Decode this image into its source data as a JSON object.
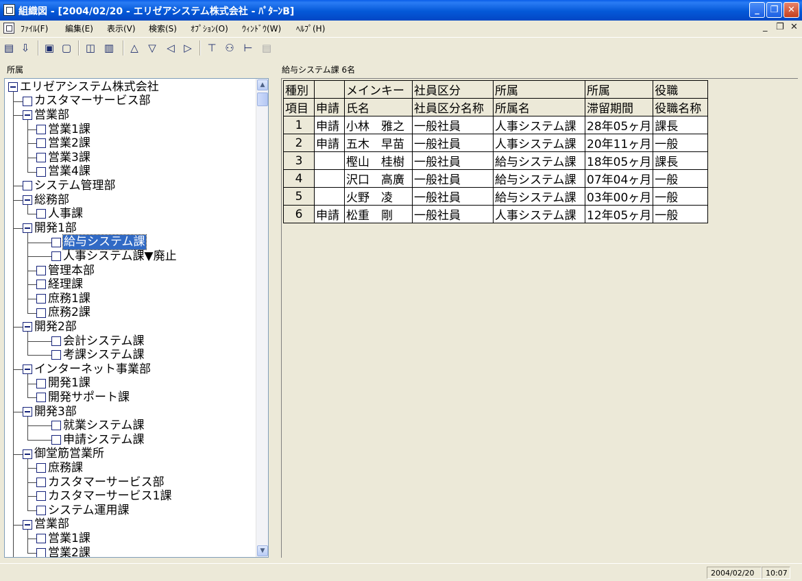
{
  "window": {
    "title": "組織図 - [2004/02/20 - エリゼアシステム株式会社 - ﾊﾟﾀｰﾝB]",
    "app_icon": "org-chart-icon"
  },
  "title_buttons": {
    "minimize": "_",
    "restore": "❐",
    "close": "✕"
  },
  "menu": {
    "items": [
      "ﾌｧｲﾙ(F)",
      "編集(E)",
      "表示(V)",
      "検索(S)",
      "ｵﾌﾟｼｮﾝ(O)",
      "ｳｨﾝﾄﾞｳ(W)",
      "ﾍﾙﾌﾟ(H)"
    ],
    "mdi_minimize": "_",
    "mdi_restore": "❐",
    "mdi_close": "✕"
  },
  "toolbar": {
    "tools": [
      {
        "icon": "book-icon",
        "glyph": "▤",
        "enabled": true
      },
      {
        "icon": "import-icon",
        "glyph": "⇩",
        "enabled": true
      },
      {
        "icon": "save-icon",
        "glyph": "▣",
        "enabled": true
      },
      {
        "icon": "print-setup-icon",
        "glyph": "▢",
        "enabled": true
      },
      {
        "icon": "print-preview-icon",
        "glyph": "◫",
        "enabled": true
      },
      {
        "icon": "print-icon",
        "glyph": "▥",
        "enabled": true
      },
      {
        "icon": "move-up-icon",
        "glyph": "△",
        "enabled": true
      },
      {
        "icon": "move-down-icon",
        "glyph": "▽",
        "enabled": true
      },
      {
        "icon": "move-left-icon",
        "glyph": "◁",
        "enabled": true
      },
      {
        "icon": "move-right-icon",
        "glyph": "▷",
        "enabled": true
      },
      {
        "icon": "org-node-icon",
        "glyph": "⊤",
        "enabled": true
      },
      {
        "icon": "person-icon",
        "glyph": "⚇",
        "enabled": true
      },
      {
        "icon": "tree-view-icon",
        "glyph": "⊢",
        "enabled": true
      },
      {
        "icon": "notes-icon",
        "glyph": "▤",
        "enabled": false
      }
    ]
  },
  "left_pane": {
    "label": "所属",
    "tree": [
      {
        "label": "エリゼアシステム株式会社",
        "depth": 0,
        "expanded": true
      },
      {
        "label": "カスタマーサービス部",
        "depth": 1
      },
      {
        "label": "営業部",
        "depth": 1,
        "expanded": true
      },
      {
        "label": "営業1課",
        "depth": 2
      },
      {
        "label": "営業2課",
        "depth": 2
      },
      {
        "label": "営業3課",
        "depth": 2
      },
      {
        "label": "営業4課",
        "depth": 2
      },
      {
        "label": "システム管理部",
        "depth": 1
      },
      {
        "label": "総務部",
        "depth": 1,
        "expanded": true
      },
      {
        "label": "人事課",
        "depth": 2
      },
      {
        "label": "開発1部",
        "depth": 1,
        "expanded": true
      },
      {
        "label": "給与システム課",
        "depth": 3,
        "selected": true
      },
      {
        "label": "人事システム課▼廃止",
        "depth": 3
      },
      {
        "label": "管理本部",
        "depth": 2
      },
      {
        "label": "経理課",
        "depth": 2
      },
      {
        "label": "庶務1課",
        "depth": 2
      },
      {
        "label": "庶務2課",
        "depth": 2
      },
      {
        "label": "開発2部",
        "depth": 1,
        "expanded": true
      },
      {
        "label": "会計システム課",
        "depth": 3
      },
      {
        "label": "考課システム課",
        "depth": 3
      },
      {
        "label": "インターネット事業部",
        "depth": 1,
        "expanded": true
      },
      {
        "label": "開発1課",
        "depth": 2
      },
      {
        "label": "開発サポート課",
        "depth": 2
      },
      {
        "label": "開発3部",
        "depth": 1,
        "expanded": true
      },
      {
        "label": "就業システム課",
        "depth": 3
      },
      {
        "label": "申請システム課",
        "depth": 3
      },
      {
        "label": "御堂筋営業所",
        "depth": 1,
        "expanded": true
      },
      {
        "label": "庶務課",
        "depth": 2
      },
      {
        "label": "カスタマーサービス部",
        "depth": 2
      },
      {
        "label": "カスタマーサービス1課",
        "depth": 2
      },
      {
        "label": "システム運用課",
        "depth": 2
      },
      {
        "label": "営業部",
        "depth": 1,
        "expanded": true
      },
      {
        "label": "営業1課",
        "depth": 2
      },
      {
        "label": "営業2課",
        "depth": 2
      }
    ]
  },
  "right_pane": {
    "label": "給与システム課 6名",
    "header_row1": [
      "種別",
      "",
      "メインキー",
      "社員区分",
      "所属",
      "所属",
      "役職"
    ],
    "header_row2": [
      "項目",
      "申請",
      "氏名",
      "社員区分名称",
      "所属名",
      "滞留期間",
      "役職名称"
    ],
    "rows": [
      [
        "1",
        "申請",
        "小林　雅之",
        "一般社員",
        "人事システム課",
        "28年05ヶ月",
        "課長"
      ],
      [
        "2",
        "申請",
        "五木　早苗",
        "一般社員",
        "人事システム課",
        "20年11ヶ月",
        "一般"
      ],
      [
        "3",
        "",
        "樫山　桂樹",
        "一般社員",
        "給与システム課",
        "18年05ヶ月",
        "課長"
      ],
      [
        "4",
        "",
        "沢口　高廣",
        "一般社員",
        "給与システム課",
        "07年04ヶ月",
        "一般"
      ],
      [
        "5",
        "",
        "火野　凌",
        "一般社員",
        "給与システム課",
        "03年00ヶ月",
        "一般"
      ],
      [
        "6",
        "申請",
        "松重　剛",
        "一般社員",
        "人事システム課",
        "12年05ヶ月",
        "一般"
      ]
    ]
  },
  "status": {
    "date": "2004/02/20",
    "time": "10:07"
  }
}
